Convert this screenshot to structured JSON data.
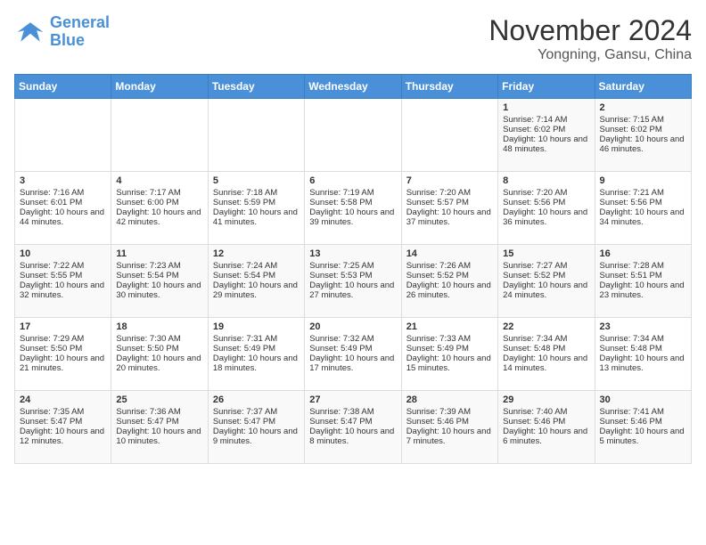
{
  "logo": {
    "line1": "General",
    "line2": "Blue"
  },
  "title": "November 2024",
  "subtitle": "Yongning, Gansu, China",
  "days_of_week": [
    "Sunday",
    "Monday",
    "Tuesday",
    "Wednesday",
    "Thursday",
    "Friday",
    "Saturday"
  ],
  "weeks": [
    [
      {
        "day": "",
        "info": ""
      },
      {
        "day": "",
        "info": ""
      },
      {
        "day": "",
        "info": ""
      },
      {
        "day": "",
        "info": ""
      },
      {
        "day": "",
        "info": ""
      },
      {
        "day": "1",
        "info": "Sunrise: 7:14 AM\nSunset: 6:02 PM\nDaylight: 10 hours and 48 minutes."
      },
      {
        "day": "2",
        "info": "Sunrise: 7:15 AM\nSunset: 6:02 PM\nDaylight: 10 hours and 46 minutes."
      }
    ],
    [
      {
        "day": "3",
        "info": "Sunrise: 7:16 AM\nSunset: 6:01 PM\nDaylight: 10 hours and 44 minutes."
      },
      {
        "day": "4",
        "info": "Sunrise: 7:17 AM\nSunset: 6:00 PM\nDaylight: 10 hours and 42 minutes."
      },
      {
        "day": "5",
        "info": "Sunrise: 7:18 AM\nSunset: 5:59 PM\nDaylight: 10 hours and 41 minutes."
      },
      {
        "day": "6",
        "info": "Sunrise: 7:19 AM\nSunset: 5:58 PM\nDaylight: 10 hours and 39 minutes."
      },
      {
        "day": "7",
        "info": "Sunrise: 7:20 AM\nSunset: 5:57 PM\nDaylight: 10 hours and 37 minutes."
      },
      {
        "day": "8",
        "info": "Sunrise: 7:20 AM\nSunset: 5:56 PM\nDaylight: 10 hours and 36 minutes."
      },
      {
        "day": "9",
        "info": "Sunrise: 7:21 AM\nSunset: 5:56 PM\nDaylight: 10 hours and 34 minutes."
      }
    ],
    [
      {
        "day": "10",
        "info": "Sunrise: 7:22 AM\nSunset: 5:55 PM\nDaylight: 10 hours and 32 minutes."
      },
      {
        "day": "11",
        "info": "Sunrise: 7:23 AM\nSunset: 5:54 PM\nDaylight: 10 hours and 30 minutes."
      },
      {
        "day": "12",
        "info": "Sunrise: 7:24 AM\nSunset: 5:54 PM\nDaylight: 10 hours and 29 minutes."
      },
      {
        "day": "13",
        "info": "Sunrise: 7:25 AM\nSunset: 5:53 PM\nDaylight: 10 hours and 27 minutes."
      },
      {
        "day": "14",
        "info": "Sunrise: 7:26 AM\nSunset: 5:52 PM\nDaylight: 10 hours and 26 minutes."
      },
      {
        "day": "15",
        "info": "Sunrise: 7:27 AM\nSunset: 5:52 PM\nDaylight: 10 hours and 24 minutes."
      },
      {
        "day": "16",
        "info": "Sunrise: 7:28 AM\nSunset: 5:51 PM\nDaylight: 10 hours and 23 minutes."
      }
    ],
    [
      {
        "day": "17",
        "info": "Sunrise: 7:29 AM\nSunset: 5:50 PM\nDaylight: 10 hours and 21 minutes."
      },
      {
        "day": "18",
        "info": "Sunrise: 7:30 AM\nSunset: 5:50 PM\nDaylight: 10 hours and 20 minutes."
      },
      {
        "day": "19",
        "info": "Sunrise: 7:31 AM\nSunset: 5:49 PM\nDaylight: 10 hours and 18 minutes."
      },
      {
        "day": "20",
        "info": "Sunrise: 7:32 AM\nSunset: 5:49 PM\nDaylight: 10 hours and 17 minutes."
      },
      {
        "day": "21",
        "info": "Sunrise: 7:33 AM\nSunset: 5:49 PM\nDaylight: 10 hours and 15 minutes."
      },
      {
        "day": "22",
        "info": "Sunrise: 7:34 AM\nSunset: 5:48 PM\nDaylight: 10 hours and 14 minutes."
      },
      {
        "day": "23",
        "info": "Sunrise: 7:34 AM\nSunset: 5:48 PM\nDaylight: 10 hours and 13 minutes."
      }
    ],
    [
      {
        "day": "24",
        "info": "Sunrise: 7:35 AM\nSunset: 5:47 PM\nDaylight: 10 hours and 12 minutes."
      },
      {
        "day": "25",
        "info": "Sunrise: 7:36 AM\nSunset: 5:47 PM\nDaylight: 10 hours and 10 minutes."
      },
      {
        "day": "26",
        "info": "Sunrise: 7:37 AM\nSunset: 5:47 PM\nDaylight: 10 hours and 9 minutes."
      },
      {
        "day": "27",
        "info": "Sunrise: 7:38 AM\nSunset: 5:47 PM\nDaylight: 10 hours and 8 minutes."
      },
      {
        "day": "28",
        "info": "Sunrise: 7:39 AM\nSunset: 5:46 PM\nDaylight: 10 hours and 7 minutes."
      },
      {
        "day": "29",
        "info": "Sunrise: 7:40 AM\nSunset: 5:46 PM\nDaylight: 10 hours and 6 minutes."
      },
      {
        "day": "30",
        "info": "Sunrise: 7:41 AM\nSunset: 5:46 PM\nDaylight: 10 hours and 5 minutes."
      }
    ]
  ]
}
